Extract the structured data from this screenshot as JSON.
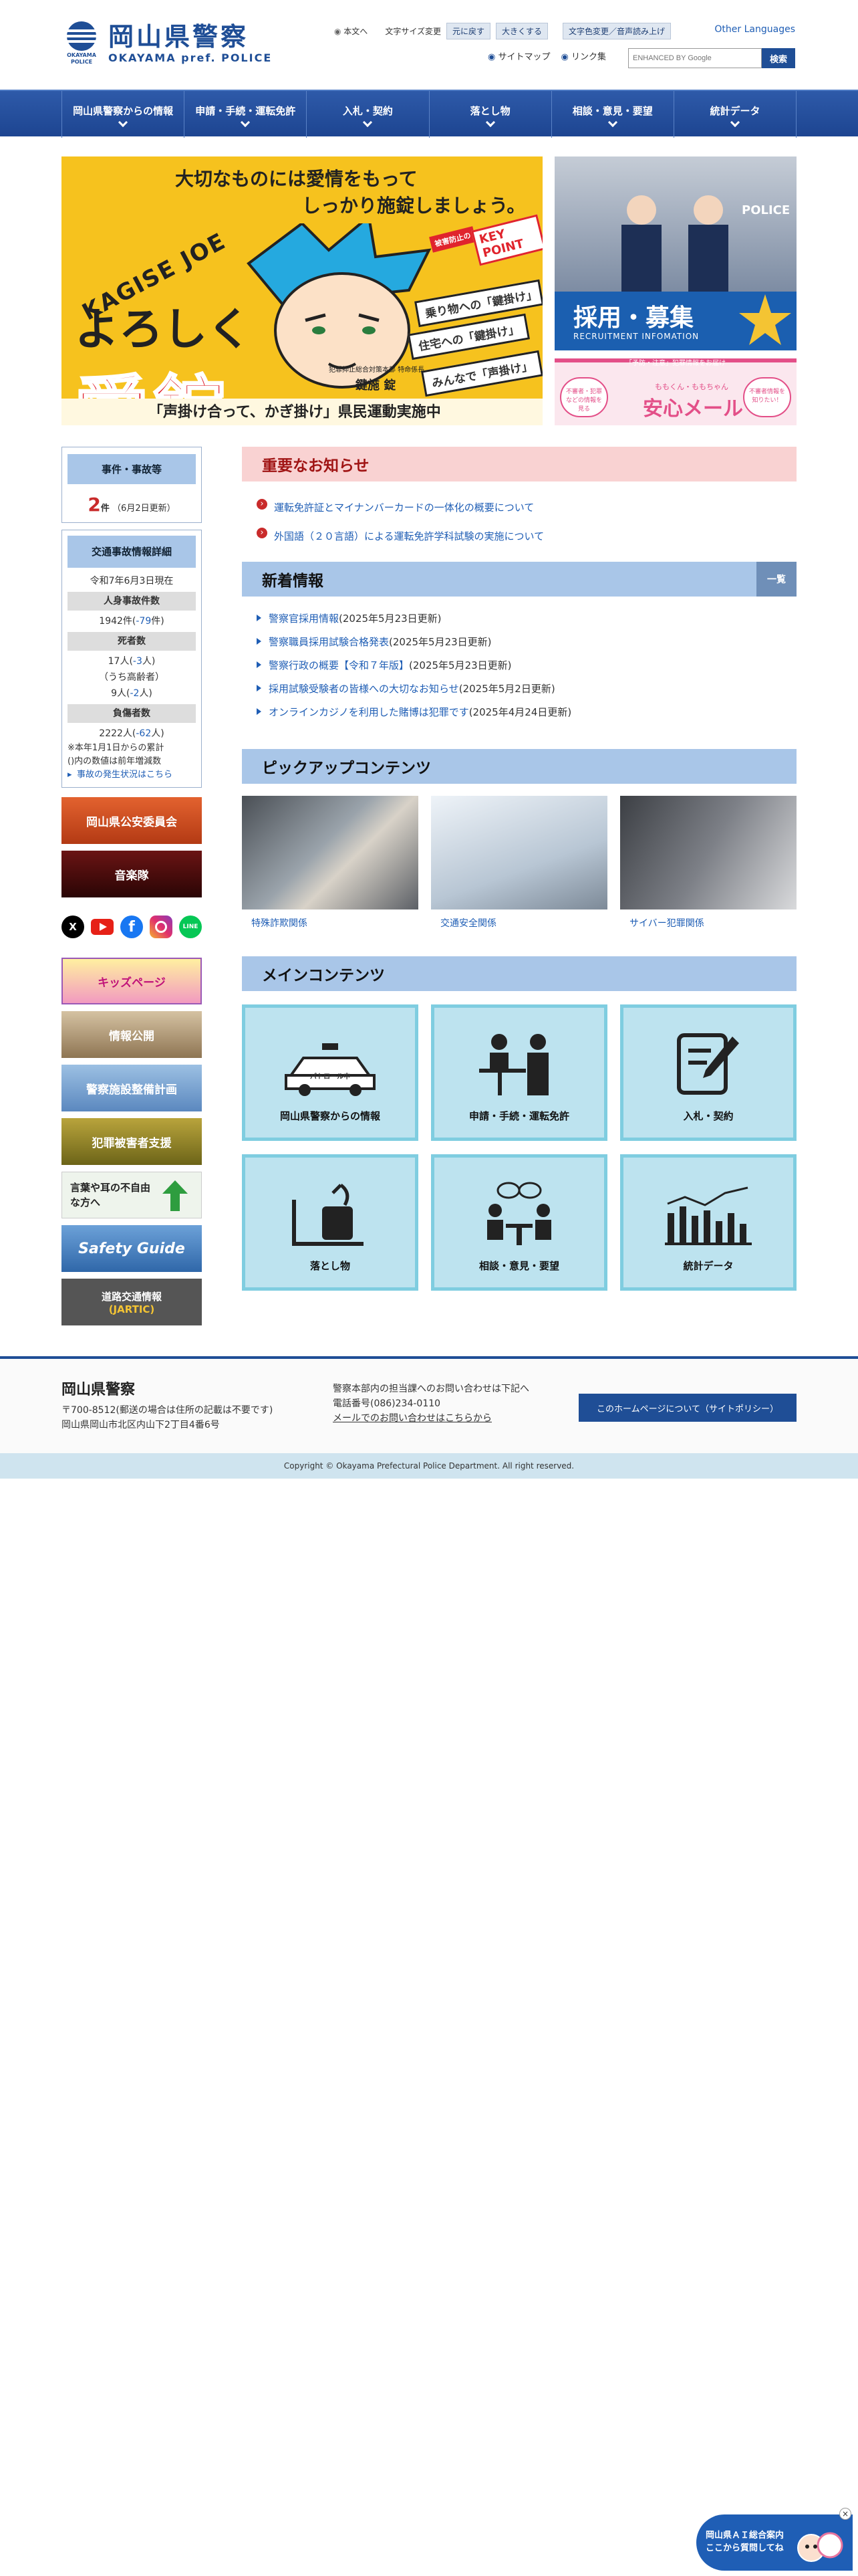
{
  "header": {
    "logo_jp": "岡山県警察",
    "logo_en": "OKAYAMA pref. POLICE",
    "emblem_text": "OKAYAMA POLICE",
    "skip_link": "本文へ",
    "fontsize_label": "文字サイズ変更",
    "fontsize_reset": "元に戻す",
    "fontsize_larger": "大きくする",
    "color_voice": "文字色変更／音声読み上げ",
    "other_languages": "Other Languages",
    "sitemap": "サイトマップ",
    "links": "リンク集",
    "search_placeholder": "ENHANCED BY Google",
    "search_button": "検索"
  },
  "nav": {
    "items": [
      {
        "label": "岡山県警察からの情報"
      },
      {
        "label": "申請・手続・運転免許"
      },
      {
        "label": "入札・契約"
      },
      {
        "label": "落とし物"
      },
      {
        "label": "相談・意見・要望"
      },
      {
        "label": "統計データ"
      }
    ]
  },
  "hero": {
    "line1": "大切なものには愛情をもって",
    "line2": "しっかり施錠しましょう。",
    "kagise": "KAGISE JOE",
    "big1": "よろしく",
    "big2": "愛錠",
    "tags": [
      "乗り物への「鍵掛け」",
      "住宅への「鍵掛け」",
      "みんなで「声掛け」"
    ],
    "keypoint": "KEY POINT",
    "keypoint_sub": "被害防止の",
    "character": "鍵施 錠",
    "character_role": "犯罪抑止総合対策本部 特命係長",
    "caption": "「声掛け合って、かぎ掛け」県民運動実施中",
    "prev": "‹",
    "pause": "❙❙",
    "next": "›"
  },
  "banner_recruit": {
    "sign": "POLICE",
    "title": "採用・募集",
    "sub": "RECRUITMENT INFOMATION"
  },
  "banner_mail": {
    "top": "「予防・注意」犯罪情報をお届け",
    "brand": "ももくん・ももちゃん",
    "title": "安心メール",
    "left_bubble": "不審者・犯罪などの情報を見る",
    "right_bubble": "不審者情報を知りたい！"
  },
  "sidebar": {
    "incidents_title": "事件・事故等",
    "incidents_count": "2",
    "incidents_unit": "件",
    "incidents_date": "（6月2日更新）",
    "traffic_title": "交通事故情報詳細",
    "traffic_date": "令和7年6月3日現在",
    "injury_label": "人身事故件数",
    "injury_value": "1942件(",
    "injury_delta": "-79",
    "injury_tail": "件)",
    "death_label": "死者数",
    "death_value": "17人(",
    "death_delta": "-3",
    "death_tail": "人)",
    "elderly_label": "（うち高齢者）",
    "elderly_value": "9人(",
    "elderly_delta": "-2",
    "elderly_tail": "人)",
    "injured_label": "負傷者数",
    "injured_value": "2222人(",
    "injured_delta": "-62",
    "injured_tail": "人)",
    "note1": "※本年1月1日からの累計",
    "note2": "()内の数値は前年増減数",
    "status_link": "事故の発生状況はこちら",
    "banners": [
      {
        "label": "岡山県公安委員会"
      },
      {
        "label": "音楽隊"
      },
      {
        "label": "キッズページ"
      },
      {
        "label": "情報公開"
      },
      {
        "label": "警察施設整備計画"
      },
      {
        "label": "犯罪被害者支援"
      },
      {
        "label": "言葉や耳の不自由な方へ"
      },
      {
        "label": "Safety Guide"
      },
      {
        "label": "道路交通情報"
      },
      {
        "label": "(JARTIC)"
      }
    ],
    "sns": [
      "X",
      "YouTube",
      "Facebook",
      "Instagram",
      "LINE"
    ]
  },
  "important": {
    "title": "重要なお知らせ",
    "items": [
      {
        "text": "運転免許証とマイナンバーカードの一体化の概要について"
      },
      {
        "text": "外国語（２０言語）による運転免許学科試験の実施について"
      }
    ]
  },
  "news": {
    "title": "新着情報",
    "list_button": "一覧",
    "items": [
      {
        "text": "警察官採用情報",
        "date": "(2025年5月23日更新)"
      },
      {
        "text": "警察職員採用試験合格発表",
        "date": "(2025年5月23日更新)"
      },
      {
        "text": "警察行政の概要【令和７年版】",
        "date": "(2025年5月23日更新)"
      },
      {
        "text": "採用試験受験者の皆様への大切なお知らせ",
        "date": "(2025年5月2日更新)"
      },
      {
        "text": "オンラインカジノを利用した賭博は犯罪です",
        "date": "(2025年4月24日更新)"
      }
    ]
  },
  "pickup": {
    "title": "ピックアップコンテンツ",
    "items": [
      {
        "caption": "特殊詐欺関係"
      },
      {
        "caption": "交通安全関係"
      },
      {
        "caption": "サイバー犯罪関係"
      }
    ]
  },
  "main_contents": {
    "title": "メインコンテンツ",
    "tiles": [
      {
        "label": "岡山県警察からの情報",
        "badge": "パトロール中"
      },
      {
        "label": "申請・手続・運転免許"
      },
      {
        "label": "入札・契約"
      },
      {
        "label": "落とし物"
      },
      {
        "label": "相談・意見・要望"
      },
      {
        "label": "統計データ"
      }
    ]
  },
  "footer": {
    "org": "岡山県警察",
    "address1": "〒700-8512(郵送の場合は住所の記載は不要です)",
    "address2": "岡山県岡山市北区内山下2丁目4番6号",
    "contact1": "警察本部内の担当課へのお問い合わせは下記へ",
    "contact2": "電話番号(086)234-0110",
    "contact_link": "メールでのお問い合わせはこちらから",
    "about_button": "このホームページについて（サイトポリシー）",
    "copyright": "Copyright © Okayama Prefectural Police Department. All right reserved."
  },
  "chatbot": {
    "line1": "岡山県ＡＩ総合案内",
    "line2": "ここから質問してね",
    "close": "×"
  },
  "colors": {
    "brand": "#1f4e96",
    "nav": "#2451a0",
    "important_bg": "#f9d2d2",
    "section_bg": "#a9c6e8",
    "tile_bg": "#bde3ef"
  }
}
